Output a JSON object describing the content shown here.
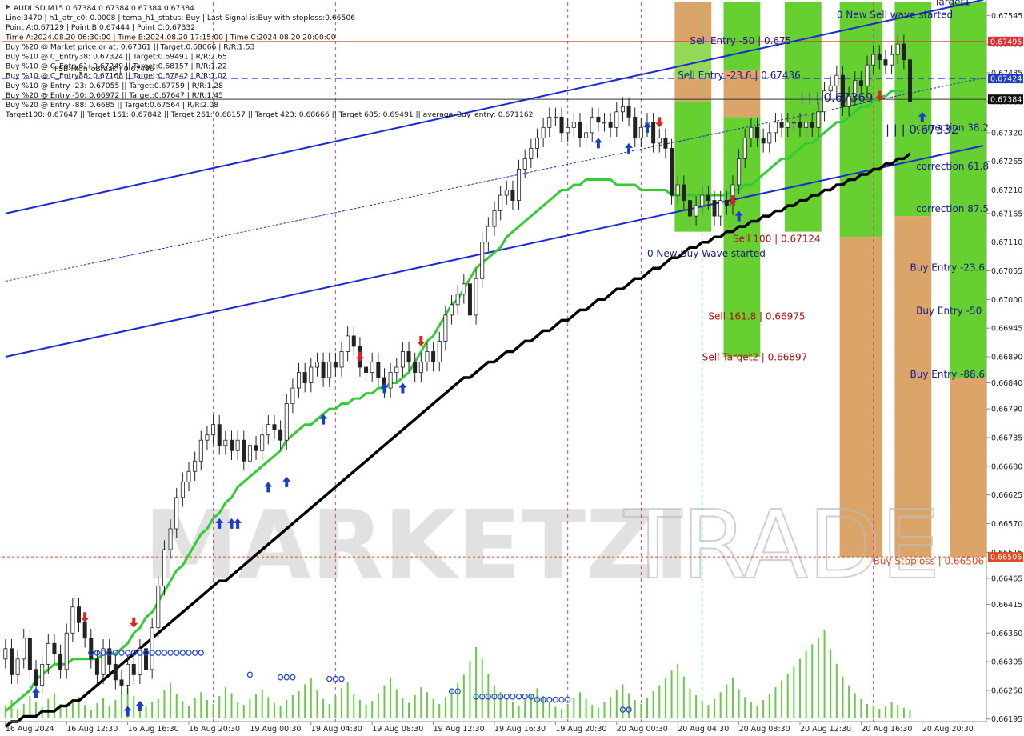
{
  "header_lines": [
    "AUDUSD,M15  0.67384 0.67384 0.67384 0.67384",
    "Line:3470 | h1_atr_c0: 0.0008 | tema_h1_status: Buy | Last Signal is:Buy with stoploss:0.66506",
    "Point A:0.67129 | Point B:0.67444 | Point C:0.67332",
    "Time A:2024.08.20 06:30:00 | Time B:2024.08.20 17:15:00 | Time C:2024.08.20 20:00:00",
    "Buy %20 @ Market price or at: 0.67361 || Target:0.68666 | R/R:1.53",
    "Buy %10 @ C_Entry38: 0.67324 || Target:0.69491 | R/R:2.65",
    "Buy %10 @ C_Entry61: 0.67249 || Target:0.68157 | R/R:1.22",
    "Buy %10 @ C_Entry88: 0.67168 || Target:0.67842 | R/R:1.02",
    "Buy %10 @ Entry -23: 0.67055 || Target:0.67759 | R/R:1.28",
    "Buy %20 @ Entry -50: 0.66972 || Target:0.67647 | R/R:1.45",
    "Buy %20 @ Entry -88: 0.6685 || Target:0.67564 | R/R:2.08",
    "Target100: 0.67647 || Target 161: 0.67842 || Target 261: 0.68157 || Target 423: 0.68666 || Target 685: 0.69491 || average_Buy_entry: 0.671162"
  ],
  "fsb_label": "FSB-HighToBreak | 0.67496",
  "watermark": {
    "left": "MARKETZI",
    "right": "TRADE"
  },
  "price_tags": [
    {
      "text": "0.67495",
      "price": 0.67495,
      "color": "#e03030"
    },
    {
      "text": "0.67424",
      "price": 0.67424,
      "color": "#1e3cc8"
    },
    {
      "text": "0.67384",
      "price": 0.67384,
      "color": "#111111"
    },
    {
      "text": "0.66506",
      "price": 0.66506,
      "color": "#e04a20"
    }
  ],
  "zone_labels": [
    {
      "text": "Sell Entry -50 | 0.675",
      "color": "#1a1a8c",
      "price": 0.6749,
      "xi": 112
    },
    {
      "text": "Sell Entry -23.6 | 0.67436",
      "color": "#1a1a8c",
      "price": 0.67424,
      "xi": 110
    },
    {
      "text": "Sell 100 | 0.67124",
      "color": "#b01010",
      "price": 0.6711,
      "xi": 119
    },
    {
      "text": "0 New Buy Wave started",
      "color": "#1a1a8c",
      "price": 0.67082,
      "xi": 105
    },
    {
      "text": "Sell 161.8 | 0.66975",
      "color": "#b01010",
      "price": 0.66961,
      "xi": 115
    },
    {
      "text": "Sell Target2 | 0.66897",
      "color": "#b01010",
      "price": 0.66883,
      "xi": 114
    },
    {
      "text": "0 New Sell wave started",
      "color": "#1a1a8c",
      "price": 0.6754,
      "xi": 136
    },
    {
      "text": "Target1",
      "color": "#1a1a8c",
      "price": 0.67565,
      "xi": 152
    },
    {
      "text": "correction 38.2",
      "color": "#1a1a8c",
      "price": 0.67324,
      "xi": 149
    },
    {
      "text": "correction 61.8",
      "color": "#1a1a8c",
      "price": 0.67249,
      "xi": 149
    },
    {
      "text": "correction 87.5",
      "color": "#1a1a8c",
      "price": 0.67168,
      "xi": 149
    },
    {
      "text": "Buy Entry -23.6",
      "color": "#1a1a8c",
      "price": 0.67055,
      "xi": 148
    },
    {
      "text": "Buy Entry -50",
      "color": "#1a1a8c",
      "price": 0.66972,
      "xi": 149
    },
    {
      "text": "Buy Entry -88.6",
      "color": "#1a1a8c",
      "price": 0.6685,
      "xi": 148
    },
    {
      "text": "Buy Stoploss | 0.66506",
      "color": "#e04a20",
      "price": 0.66492,
      "xi": 142
    }
  ],
  "big_labels": [
    {
      "text": "| | | 0.67369",
      "price": 0.6738,
      "xi": 130
    },
    {
      "text": "| | | 0.67332",
      "price": 0.67318,
      "xi": 144
    }
  ],
  "chart_data": {
    "type": "candlestick",
    "symbol": "AUDUSD",
    "timeframe": "M15",
    "ylim": [
      0.6619,
      0.6757
    ],
    "y_ticks": [
      0.67545,
      0.6749,
      0.67435,
      0.6738,
      0.6732,
      0.67265,
      0.6721,
      0.67165,
      0.6711,
      0.67055,
      0.67,
      0.66945,
      0.6689,
      0.6684,
      0.6679,
      0.66735,
      0.6668,
      0.66625,
      0.6657,
      0.66515,
      0.66465,
      0.66415,
      0.6636,
      0.66305,
      0.6625,
      0.66195
    ],
    "x_labels": [
      "16 Aug 2024",
      "16 Aug 12:30",
      "16 Aug 16:30",
      "16 Aug 20:30",
      "19 Aug 00:30",
      "19 Aug 04:30",
      "19 Aug 08:30",
      "19 Aug 12:30",
      "19 Aug 16:30",
      "19 Aug 20:30",
      "20 Aug 00:30",
      "20 Aug 04:30",
      "20 Aug 08:30",
      "20 Aug 12:30",
      "20 Aug 16:30",
      "20 Aug 20:30"
    ],
    "bars_per_label": 10,
    "close": [
      0.6633,
      0.6628,
      0.6631,
      0.6635,
      0.6629,
      0.6626,
      0.663,
      0.6634,
      0.6632,
      0.6629,
      0.6636,
      0.6641,
      0.6638,
      0.6635,
      0.6631,
      0.6628,
      0.6633,
      0.663,
      0.6627,
      0.6626,
      0.663,
      0.6628,
      0.6633,
      0.6629,
      0.6637,
      0.6645,
      0.6652,
      0.6656,
      0.6662,
      0.6665,
      0.6667,
      0.6669,
      0.6673,
      0.6674,
      0.6676,
      0.6672,
      0.6673,
      0.6671,
      0.6673,
      0.6669,
      0.6672,
      0.6671,
      0.6674,
      0.6676,
      0.6675,
      0.6673,
      0.668,
      0.6683,
      0.6686,
      0.6684,
      0.6687,
      0.6688,
      0.6685,
      0.6688,
      0.6687,
      0.669,
      0.6693,
      0.6691,
      0.6687,
      0.6686,
      0.6688,
      0.6685,
      0.6683,
      0.6686,
      0.6687,
      0.669,
      0.6688,
      0.6686,
      0.6688,
      0.669,
      0.6688,
      0.6692,
      0.6697,
      0.6699,
      0.6701,
      0.6703,
      0.6697,
      0.6704,
      0.6711,
      0.6714,
      0.6717,
      0.672,
      0.6721,
      0.6719,
      0.6725,
      0.6727,
      0.6729,
      0.6731,
      0.6733,
      0.6735,
      0.6735,
      0.6732,
      0.6733,
      0.6734,
      0.6731,
      0.6732,
      0.6735,
      0.6734,
      0.6734,
      0.6733,
      0.6736,
      0.6737,
      0.6735,
      0.6731,
      0.6733,
      0.6734,
      0.673,
      0.6731,
      0.6729,
      0.672,
      0.6722,
      0.6719,
      0.6716,
      0.6718,
      0.672,
      0.6719,
      0.6716,
      0.6719,
      0.6718,
      0.6722,
      0.6727,
      0.6731,
      0.6733,
      0.6731,
      0.673,
      0.6732,
      0.6734,
      0.6733,
      0.6734,
      0.6734,
      0.6733,
      0.6734,
      0.6733,
      0.6736,
      0.674,
      0.6741,
      0.6743,
      0.6737,
      0.6739,
      0.6742,
      0.6741,
      0.6745,
      0.6747,
      0.6746,
      0.6745,
      0.6747,
      0.6749,
      0.6746,
      0.6738
    ],
    "series": [
      {
        "name": "EMA",
        "color": "#33cc33",
        "values": [
          0.6621,
          0.6622,
          0.6623,
          0.6624,
          0.6625,
          0.6627,
          0.6628,
          0.6629,
          0.663,
          0.663,
          0.663,
          0.6631,
          0.6631,
          0.6631,
          0.6631,
          0.6631,
          0.6632,
          0.6632,
          0.6632,
          0.6633,
          0.6634,
          0.6636,
          0.6637,
          0.6639,
          0.664,
          0.6642,
          0.6644,
          0.6646,
          0.6648,
          0.6649,
          0.6651,
          0.6653,
          0.6655,
          0.6656,
          0.6658,
          0.6659,
          0.6661,
          0.6662,
          0.6664,
          0.6665,
          0.6666,
          0.6667,
          0.6668,
          0.6669,
          0.667,
          0.6671,
          0.6673,
          0.6674,
          0.6675,
          0.6676,
          0.6676,
          0.6677,
          0.6678,
          0.6679,
          0.6679,
          0.668,
          0.668,
          0.6681,
          0.6681,
          0.6682,
          0.6682,
          0.6683,
          0.6683,
          0.6684,
          0.6684,
          0.6685,
          0.6686,
          0.6688,
          0.669,
          0.6692,
          0.6693,
          0.6695,
          0.6697,
          0.6699,
          0.67,
          0.6702,
          0.6704,
          0.6706,
          0.6707,
          0.6708,
          0.6709,
          0.671,
          0.6712,
          0.6713,
          0.6714,
          0.6715,
          0.6716,
          0.6717,
          0.6718,
          0.6719,
          0.672,
          0.6721,
          0.6721,
          0.6722,
          0.6722,
          0.6723,
          0.6723,
          0.6723,
          0.6723,
          0.6723,
          0.6722,
          0.6722,
          0.6722,
          0.6722,
          0.6721,
          0.6721,
          0.6721,
          0.6721,
          0.6721,
          0.672,
          0.672,
          0.672,
          0.672,
          0.672,
          0.672,
          0.672,
          0.672,
          0.672,
          0.672,
          0.6721,
          0.6721,
          0.6722,
          0.6722,
          0.6723,
          0.6724,
          0.6725,
          0.6726,
          0.6727,
          0.6727,
          0.6728,
          0.6729,
          0.673,
          0.673,
          0.6731,
          0.6732,
          0.6733,
          0.6734,
          0.6734,
          0.6735,
          0.6736,
          0.6737,
          0.6737,
          0.6738,
          0.6739,
          0.6739,
          0.674,
          0.674,
          0.674
        ]
      },
      {
        "name": "SMA",
        "color": "#000000",
        "values": [
          0.6618,
          0.6619,
          0.6619,
          0.662,
          0.662,
          0.662,
          0.6621,
          0.6621,
          0.6621,
          0.6622,
          0.6622,
          0.6623,
          0.6623,
          0.6624,
          0.6625,
          0.6626,
          0.6627,
          0.6628,
          0.6629,
          0.663,
          0.6631,
          0.6632,
          0.6633,
          0.6634,
          0.6635,
          0.6636,
          0.6637,
          0.6638,
          0.6639,
          0.664,
          0.6641,
          0.6642,
          0.6643,
          0.6644,
          0.6645,
          0.6646,
          0.6646,
          0.6647,
          0.6648,
          0.6649,
          0.665,
          0.6651,
          0.6652,
          0.6653,
          0.6654,
          0.6655,
          0.6656,
          0.6657,
          0.6658,
          0.6659,
          0.666,
          0.6661,
          0.6662,
          0.6663,
          0.6664,
          0.6665,
          0.6666,
          0.6667,
          0.6668,
          0.6669,
          0.667,
          0.6671,
          0.6672,
          0.6673,
          0.6674,
          0.6675,
          0.6676,
          0.6677,
          0.6678,
          0.6679,
          0.668,
          0.6681,
          0.6682,
          0.6683,
          0.6684,
          0.6685,
          0.6685,
          0.6686,
          0.6687,
          0.6688,
          0.6688,
          0.6689,
          0.669,
          0.669,
          0.6691,
          0.6692,
          0.6692,
          0.6693,
          0.6694,
          0.6694,
          0.6695,
          0.6696,
          0.6696,
          0.6697,
          0.6698,
          0.6698,
          0.6699,
          0.67,
          0.67,
          0.6701,
          0.6702,
          0.6702,
          0.6703,
          0.6704,
          0.6704,
          0.6705,
          0.6706,
          0.6706,
          0.6707,
          0.6708,
          0.6708,
          0.6709,
          0.671,
          0.671,
          0.6711,
          0.6711,
          0.6712,
          0.6712,
          0.6713,
          0.6713,
          0.6714,
          0.6714,
          0.6715,
          0.6715,
          0.6716,
          0.6716,
          0.6717,
          0.6717,
          0.6718,
          0.6718,
          0.6719,
          0.6719,
          0.672,
          0.672,
          0.6721,
          0.6721,
          0.6722,
          0.6722,
          0.6723,
          0.6723,
          0.6724,
          0.6724,
          0.6725,
          0.6725,
          0.6726,
          0.6726,
          0.6727,
          0.6727,
          0.6728,
          0.6728
        ]
      }
    ],
    "channel_lines": [
      {
        "name": "upper-channel",
        "color": "#1a2ad0",
        "width": 2,
        "p1": [
          0,
          0.67165
        ],
        "p2": [
          160,
          0.67575
        ]
      },
      {
        "name": "lower-channel",
        "color": "#1a2ad0",
        "width": 2,
        "p1": [
          0,
          0.6689
        ],
        "p2": [
          160,
          0.67295
        ]
      },
      {
        "name": "middle-channel",
        "color": "#1a2ad0",
        "width": 1,
        "dash": "3,2",
        "p1": [
          0,
          0.67035
        ],
        "p2": [
          160,
          0.67425
        ]
      }
    ],
    "hlines": [
      {
        "name": "fsb-line",
        "price": 0.67495,
        "color": "#e03030",
        "dash": "",
        "width": 1
      },
      {
        "name": "sell-entry-23-line",
        "price": 0.67424,
        "color": "#1a2ad0",
        "dash": "8,5",
        "width": 1
      },
      {
        "name": "bid-line",
        "price": 0.67384,
        "color": "#333333",
        "dash": "",
        "width": 1
      },
      {
        "name": "stoploss-line",
        "price": 0.66506,
        "color": "#e04a20",
        "dash": "3,3",
        "width": 1
      }
    ],
    "zones": [
      {
        "name": "sell-zone-1",
        "x": 110,
        "w": 6,
        "segments": [
          [
            0.6757,
            0.67495,
            "#d9a061"
          ],
          [
            0.67495,
            0.67424,
            "#8fd64d"
          ],
          [
            0.67424,
            0.6738,
            "#d9a061"
          ],
          [
            0.6738,
            0.6713,
            "#5fcd26"
          ]
        ]
      },
      {
        "name": "sell-zone-2",
        "x": 118,
        "w": 6,
        "segments": [
          [
            0.6757,
            0.6744,
            "#5fcd26"
          ],
          [
            0.6744,
            0.6735,
            "#d9a061"
          ],
          [
            0.6735,
            0.6689,
            "#5fcd26"
          ]
        ]
      },
      {
        "name": "sell-zone-3",
        "x": 128,
        "w": 6,
        "segments": [
          [
            0.6757,
            0.6713,
            "#5fcd26"
          ]
        ]
      },
      {
        "name": "buy-zone-1",
        "x": 137,
        "w": 7,
        "segments": [
          [
            0.6757,
            0.6712,
            "#5fcd26"
          ],
          [
            0.6712,
            0.66506,
            "#d9a061"
          ]
        ]
      },
      {
        "name": "buy-zone-2",
        "x": 146,
        "w": 6,
        "segments": [
          [
            0.6757,
            0.6716,
            "#5fcd26"
          ],
          [
            0.6716,
            0.66506,
            "#d9a061"
          ]
        ]
      },
      {
        "name": "buy-zone-3",
        "x": 155,
        "w": 6,
        "segments": [
          [
            0.6757,
            0.6685,
            "#5fcd26"
          ],
          [
            0.6685,
            0.66506,
            "#d9a061"
          ]
        ]
      }
    ],
    "vlines": [
      {
        "xi": 34,
        "color": "#e0409a",
        "dash": "4,4"
      },
      {
        "xi": 54,
        "color": "#e0409a",
        "dash": "4,4"
      },
      {
        "xi": 92,
        "color": "#e0409a",
        "dash": "4,4"
      },
      {
        "xi": 104,
        "color": "#e0409a",
        "dash": "4,4"
      },
      {
        "xi": 114,
        "color": "#33cc77",
        "dash": "4,4"
      },
      {
        "xi": 142,
        "color": "#e0409a",
        "dash": "4,4"
      }
    ],
    "buy_arrows": [
      [
        5,
        0.66255
      ],
      [
        20,
        0.6622
      ],
      [
        22,
        0.6623
      ],
      [
        35,
        0.6658
      ],
      [
        37,
        0.6658
      ],
      [
        38,
        0.6658
      ],
      [
        43,
        0.6665
      ],
      [
        46,
        0.6666
      ],
      [
        52,
        0.6678
      ],
      [
        62,
        0.6684
      ],
      [
        65,
        0.6684
      ],
      [
        97,
        0.6731
      ],
      [
        102,
        0.673
      ],
      [
        105,
        0.6734
      ],
      [
        120,
        0.6717
      ],
      [
        150,
        0.6736
      ]
    ],
    "sell_arrows": [
      [
        13,
        0.6638
      ],
      [
        21,
        0.6637
      ],
      [
        58,
        0.6688
      ],
      [
        68,
        0.6691
      ],
      [
        107,
        0.6733
      ],
      [
        119,
        0.6718
      ],
      [
        143,
        0.6738
      ]
    ],
    "volume": [
      12,
      18,
      9,
      14,
      22,
      16,
      11,
      19,
      25,
      14,
      10,
      17,
      21,
      13,
      8,
      15,
      20,
      12,
      18,
      26,
      30,
      22,
      14,
      11,
      16,
      19,
      28,
      35,
      24,
      17,
      12,
      20,
      26,
      18,
      14,
      22,
      31,
      25,
      16,
      13,
      19,
      24,
      29,
      21,
      15,
      12,
      18,
      23,
      27,
      34,
      40,
      28,
      19,
      14,
      22,
      30,
      36,
      24,
      18,
      13,
      17,
      25,
      33,
      41,
      29,
      20,
      15,
      23,
      31,
      26,
      19,
      14,
      21,
      28,
      35,
      44,
      58,
      72,
      60,
      45,
      33,
      26,
      20,
      16,
      12,
      18,
      24,
      30,
      22,
      15,
      11,
      9,
      14,
      20,
      26,
      19,
      13,
      10,
      16,
      21,
      28,
      34,
      25,
      18,
      14,
      20,
      27,
      33,
      40,
      48,
      55,
      42,
      30,
      23,
      17,
      13,
      19,
      26,
      34,
      41,
      29,
      21,
      16,
      12,
      18,
      24,
      31,
      38,
      45,
      52,
      60,
      68,
      75,
      82,
      90,
      70,
      55,
      42,
      33,
      25,
      19,
      14,
      11,
      9,
      12,
      16,
      13,
      10,
      8,
      14
    ],
    "ellipse_runs": [
      [
        14,
        0.66322,
        19
      ],
      [
        40,
        0.6628,
        1
      ],
      [
        45,
        0.66275,
        3
      ],
      [
        53,
        0.66272,
        3
      ],
      [
        73,
        0.66248,
        2
      ],
      [
        77,
        0.66238,
        10
      ],
      [
        87,
        0.66232,
        6
      ],
      [
        101,
        0.66213,
        2
      ]
    ]
  }
}
